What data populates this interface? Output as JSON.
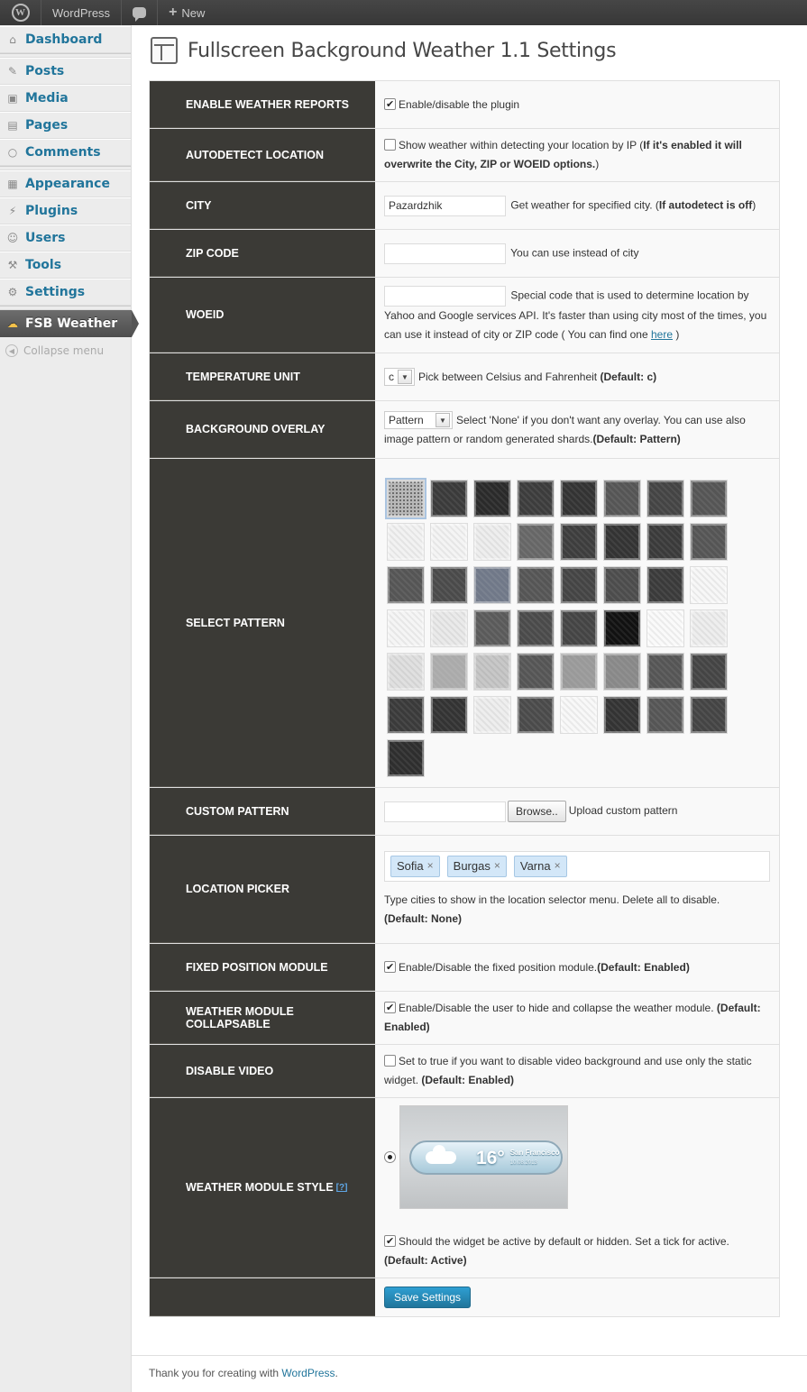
{
  "adminbar": {
    "site": "WordPress",
    "new_label": "New"
  },
  "sidebar": {
    "items": [
      {
        "label": "Dashboard",
        "icon": "dashboard-icon"
      },
      {
        "label": "Posts",
        "icon": "pin-icon"
      },
      {
        "label": "Media",
        "icon": "media-icon"
      },
      {
        "label": "Pages",
        "icon": "pages-icon"
      },
      {
        "label": "Comments",
        "icon": "comments-icon"
      },
      {
        "label": "Appearance",
        "icon": "appearance-icon"
      },
      {
        "label": "Plugins",
        "icon": "plugins-icon"
      },
      {
        "label": "Users",
        "icon": "users-icon"
      },
      {
        "label": "Tools",
        "icon": "tools-icon"
      },
      {
        "label": "Settings",
        "icon": "settings-icon"
      },
      {
        "label": "FSB Weather",
        "icon": "weather-icon"
      }
    ],
    "collapse": "Collapse menu"
  },
  "page": {
    "title": "Fullscreen Background Weather 1.1 Settings"
  },
  "rows": {
    "enable": {
      "label": "ENABLE WEATHER REPORTS",
      "text": "Enable/disable the plugin",
      "checked": true
    },
    "autodetect": {
      "label": "AUTODETECT LOCATION",
      "text": "Show weather within detecting your location by IP (",
      "bold": "If it's enabled it will overwrite the City, ZIP or WOEID options.",
      "tail": ")",
      "checked": false
    },
    "city": {
      "label": "CITY",
      "value": "Pazardzhik",
      "text": "Get weather for specified city. (",
      "bold": "If autodetect is off",
      "tail": ")"
    },
    "zip": {
      "label": "ZIP CODE",
      "value": "",
      "text": "You can use instead of city"
    },
    "woeid": {
      "label": "WOEID",
      "value": "",
      "text": "Special code that is used to determine location by Yahoo and Google services API. It's faster than using city most of the times, you can use it instead of city or ZIP code ( You can find one ",
      "link": "here",
      "tail": " )"
    },
    "unit": {
      "label": "TEMPERATURE UNIT",
      "value": "c",
      "text": "Pick between Celsius and Fahrenheit ",
      "bold": "(Default: c)"
    },
    "overlay": {
      "label": "BACKGROUND OVERLAY",
      "value": "Pattern",
      "text": "Select 'None' if you don't want any overlay. You can use also image pattern or random generated shards.",
      "bold": "(Default: Pattern)"
    },
    "pattern": {
      "label": "SELECT PATTERN"
    },
    "custom": {
      "label": "CUSTOM PATTERN",
      "value": "",
      "button": "Browse..",
      "text": "Upload custom pattern"
    },
    "location": {
      "label": "LOCATION PICKER",
      "tags": [
        "Sofia",
        "Burgas",
        "Varna"
      ],
      "text": "Type cities to show in the location selector menu. Delete all to disable.",
      "bold": "(Default: None)"
    },
    "fixed": {
      "label": "FIXED POSITION MODULE",
      "text": "Enable/Disable the fixed position module.",
      "bold": "(Default: Enabled)",
      "checked": true
    },
    "collapsable": {
      "label": "WEATHER MODULE COLLAPSABLE",
      "text": "Enable/Disable the user to hide and collapse the weather module. ",
      "bold": "(Default: Enabled)",
      "checked": true
    },
    "video": {
      "label": "DISABLE VIDEO",
      "text": "Set to true if you want to disable video background and use only the static widget. ",
      "bold": "(Default: Enabled)",
      "checked": false
    },
    "style": {
      "label": "WEATHER MODULE STYLE",
      "help": "[?]",
      "temp": "16°",
      "city": "San Francisco",
      "date": "10.08.2013",
      "text": "Should the widget be active by default or hidden. Set a tick for active.",
      "bold": "(Default: Active)",
      "checked": true
    },
    "save": {
      "button": "Save Settings"
    }
  },
  "patterns": [
    "#b8b8b8",
    "#3a3a3a",
    "#2a2a2a",
    "#3c3c3c",
    "#333333",
    "#555555",
    "#444444",
    "#555555",
    "#f2f2f2",
    "#f4f4f4",
    "#eeeeee",
    "#666666",
    "#3d3d3d",
    "#333333",
    "#3a3a3a",
    "#555555",
    "#555555",
    "#4a4a4a",
    "#707888",
    "#555555",
    "#444444",
    "#4c4c4c",
    "#3a3a3a",
    "#f7f7f7",
    "#f5f5f5",
    "#eaeaea",
    "#5a5a5a",
    "#4a4a4a",
    "#444444",
    "#111111",
    "#fafafa",
    "#eeeeee",
    "#e0e0e0",
    "#aaaaaa",
    "#c8c8c8",
    "#555555",
    "#999999",
    "#888888",
    "#555555",
    "#444444",
    "#3a3a3a",
    "#333333",
    "#eeeeee",
    "#4a4a4a",
    "#f8f8f8",
    "#333333",
    "#555555",
    "#444444",
    "#2e2e2e"
  ],
  "footer": {
    "text": "Thank you for creating with ",
    "link": "WordPress",
    "tail": "."
  }
}
